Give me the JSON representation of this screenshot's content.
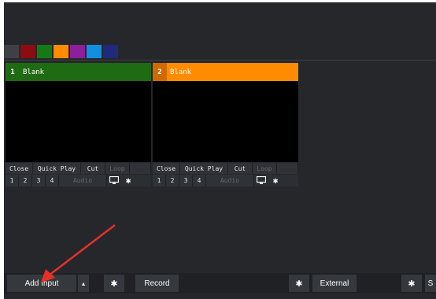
{
  "swatch_colors": [
    "#3d4044",
    "#8b0d12",
    "#157a16",
    "#ff8c00",
    "#8b1f9c",
    "#138fe0",
    "#202a7a"
  ],
  "inputs": [
    {
      "number": "1",
      "title": "Blank",
      "head_color": "#1f6b13",
      "num_color": "#1f6b13",
      "controls": [
        "Close",
        "Quick Play",
        "Cut",
        "Loop"
      ],
      "layers": [
        "1",
        "2",
        "3",
        "4"
      ],
      "audio_label": "Audio"
    },
    {
      "number": "2",
      "title": "Blank",
      "head_color": "#ff8c00",
      "num_color": "#d06a00",
      "controls": [
        "Close",
        "Quick Play",
        "Cut",
        "Loop"
      ],
      "layers": [
        "1",
        "2",
        "3",
        "4"
      ],
      "audio_label": "Audio"
    }
  ],
  "bottom_bar": {
    "add_input_label": "Add Input",
    "dropdown_glyph": "▴",
    "record_label": "Record",
    "external_label": "External",
    "cut_off_label": "S"
  },
  "annotation_color": "#e8302a"
}
